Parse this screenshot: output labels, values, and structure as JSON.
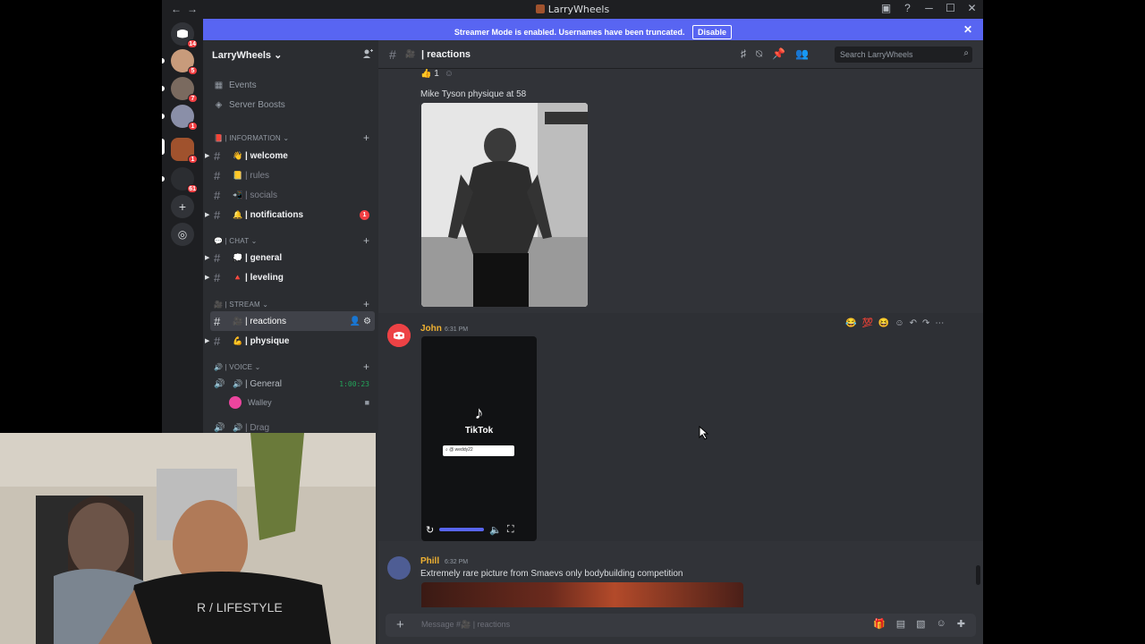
{
  "window": {
    "title": "LarryWheels",
    "back": "←",
    "forward": "→",
    "controls": [
      "▣",
      "?",
      "─",
      "☐",
      "✕"
    ]
  },
  "banner": {
    "text": "Streamer Mode is enabled. Usernames have been truncated.",
    "button": "Disable",
    "close": "✕"
  },
  "servers": {
    "badges": [
      "14",
      "5",
      "7",
      "1",
      "1",
      "61"
    ]
  },
  "sidebar": {
    "server_name": "LarryWheels",
    "chevron": "⌄",
    "top_items": [
      {
        "icon": "▦",
        "label": "Events"
      },
      {
        "icon": "◈",
        "label": "Server Boosts"
      }
    ],
    "categories": [
      {
        "label": "| INFORMATION",
        "emoji": "📕"
      },
      {
        "label": "| CHAT",
        "emoji": "💬"
      },
      {
        "label": "| STREAM",
        "emoji": "🎥"
      },
      {
        "label": "| VOICE",
        "emoji": "🔊"
      }
    ],
    "channels": {
      "welcome": {
        "emoji": "👋",
        "name": "| welcome"
      },
      "rules": {
        "emoji": "📒",
        "name": "| rules"
      },
      "socials": {
        "emoji": "📲",
        "name": "| socials"
      },
      "notifications": {
        "emoji": "🔔",
        "name": "| notifications",
        "badge": "1"
      },
      "general": {
        "emoji": "💭",
        "name": "| general"
      },
      "leveling": {
        "emoji": "🔺",
        "name": "| leveling"
      },
      "reactions": {
        "emoji": "🎥",
        "name": "| reactions"
      },
      "physique": {
        "emoji": "💪",
        "name": "| physique"
      },
      "voice_general": {
        "name": "| General",
        "timer": "1:00:23"
      },
      "voice_user": {
        "name": "Walley"
      },
      "voice_drag": {
        "name": "| Drag"
      }
    }
  },
  "header": {
    "channel": "| reactions",
    "search_placeholder": "Search LarryWheels"
  },
  "messages": {
    "reaction": {
      "emoji": "👍",
      "count": "1"
    },
    "tyson_caption": "Mike Tyson physique at 58",
    "john": {
      "name": "John",
      "time": "6:31 PM"
    },
    "tiktok": {
      "logo": "♪",
      "name": "TikTok",
      "handle": "@ weddy22"
    },
    "hover_reactions": [
      "😂",
      "💯",
      "😆"
    ],
    "phill": {
      "name": "Phill",
      "time": "6:32 PM",
      "text": "Extremely rare picture from Smaevs only bodybuilding competition"
    }
  },
  "composer": {
    "placeholder": "Message #🎥 | reactions"
  },
  "colors": {
    "accent": "#5865f2",
    "background": "#313338",
    "sidebar": "#2b2d31",
    "john_color": "#f0b232",
    "phill_color": "#f0b232"
  }
}
